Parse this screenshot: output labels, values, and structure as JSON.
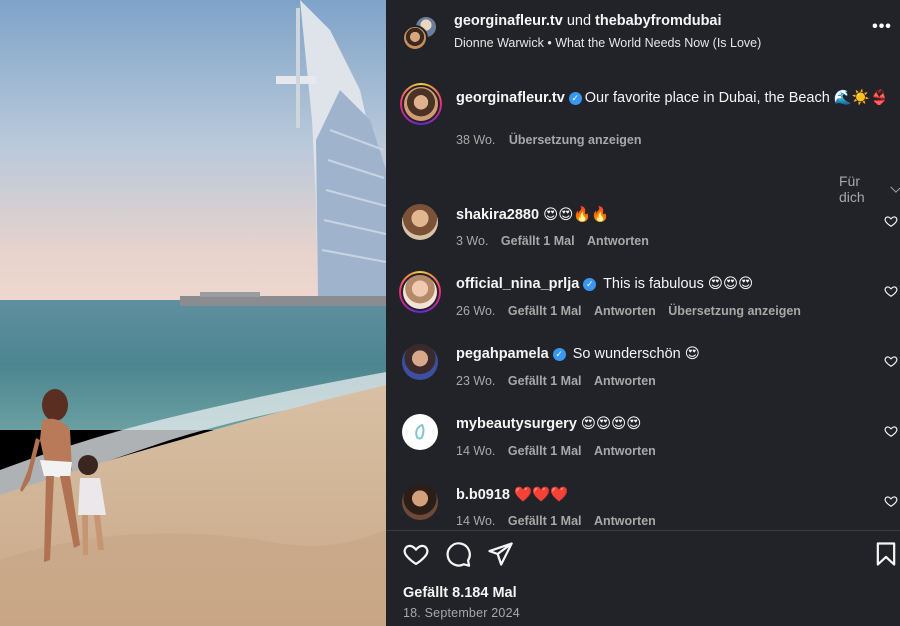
{
  "header": {
    "user1": "georginafleur.tv",
    "connector": "und",
    "user2": "thebabyfromdubai",
    "artist": "Dionne Warwick",
    "separator": "•",
    "song": "What the World Needs Now (Is Love)",
    "more_label": "•••"
  },
  "caption": {
    "username": "georginafleur.tv",
    "verified_mark": "✓",
    "text": "Our favorite place in Dubai, the Beach 🌊☀️👙",
    "age": "38 Wo.",
    "translate": "Übersetzung anzeigen"
  },
  "filter": {
    "label": "Für dich"
  },
  "comments": [
    {
      "username": "shakira2880",
      "verified": false,
      "text": "😍😍🔥🔥",
      "age": "3 Wo.",
      "likes": "Gefällt 1 Mal",
      "reply": "Antworten",
      "translate": ""
    },
    {
      "username": "official_nina_prlja",
      "verified": true,
      "text": "This is fabulous 😍😍😍",
      "age": "26 Wo.",
      "likes": "Gefällt 1 Mal",
      "reply": "Antworten",
      "translate": "Übersetzung anzeigen"
    },
    {
      "username": "pegahpamela",
      "verified": true,
      "text": "So wunderschön 😍",
      "age": "23 Wo.",
      "likes": "Gefällt 1 Mal",
      "reply": "Antworten",
      "translate": ""
    },
    {
      "username": "mybeautysurgery",
      "verified": false,
      "text": "😍😍😍😍",
      "age": "14 Wo.",
      "likes": "Gefällt 1 Mal",
      "reply": "Antworten",
      "translate": ""
    },
    {
      "username": "b.b0918",
      "verified": false,
      "text": "❤️❤️❤️",
      "age": "14 Wo.",
      "likes": "Gefällt 1 Mal",
      "reply": "Antworten",
      "translate": ""
    }
  ],
  "footer": {
    "likes": "Gefällt 8.184 Mal",
    "date": "18. September 2024"
  },
  "colors": {
    "panel_bg": "#212328",
    "verified_blue": "#3897f0",
    "muted_text": "#a8a8a8"
  }
}
